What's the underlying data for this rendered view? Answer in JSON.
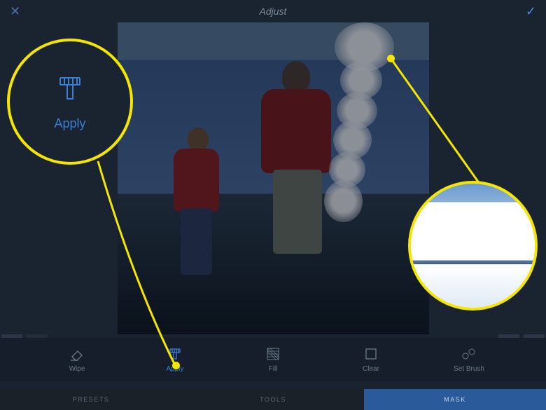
{
  "header": {
    "title": "Adjust",
    "close_icon": "close-x",
    "confirm_icon": "checkmark"
  },
  "toolbar": {
    "items": [
      {
        "id": "wipe",
        "label": "Wipe",
        "icon": "eraser-icon",
        "active": false
      },
      {
        "id": "apply",
        "label": "Apply",
        "icon": "brush-icon",
        "active": true
      },
      {
        "id": "fill",
        "label": "Fill",
        "icon": "fill-pattern-icon",
        "active": false
      },
      {
        "id": "clear",
        "label": "Clear",
        "icon": "clear-rect-icon",
        "active": false
      },
      {
        "id": "setbrush",
        "label": "Set Brush",
        "icon": "brush-settings-icon",
        "active": false
      }
    ]
  },
  "tabs": {
    "items": [
      {
        "id": "presets",
        "label": "PRESETS",
        "active": false
      },
      {
        "id": "tools",
        "label": "TOOLS",
        "active": false
      },
      {
        "id": "mask",
        "label": "MASK",
        "active": true
      }
    ]
  },
  "nav": {
    "prev_icon": "arrow-left",
    "next_icon": "arrow-right",
    "download_icon": "download",
    "copy_icon": "duplicate"
  },
  "annotations": {
    "zoom_tool": {
      "label": "Apply",
      "icon": "brush-icon",
      "color": "#f5e600"
    },
    "zoom_detail_hint": "magnified brushed highlight region",
    "highlight_color": "#f5e600",
    "accent_color": "#3a7fd6"
  }
}
